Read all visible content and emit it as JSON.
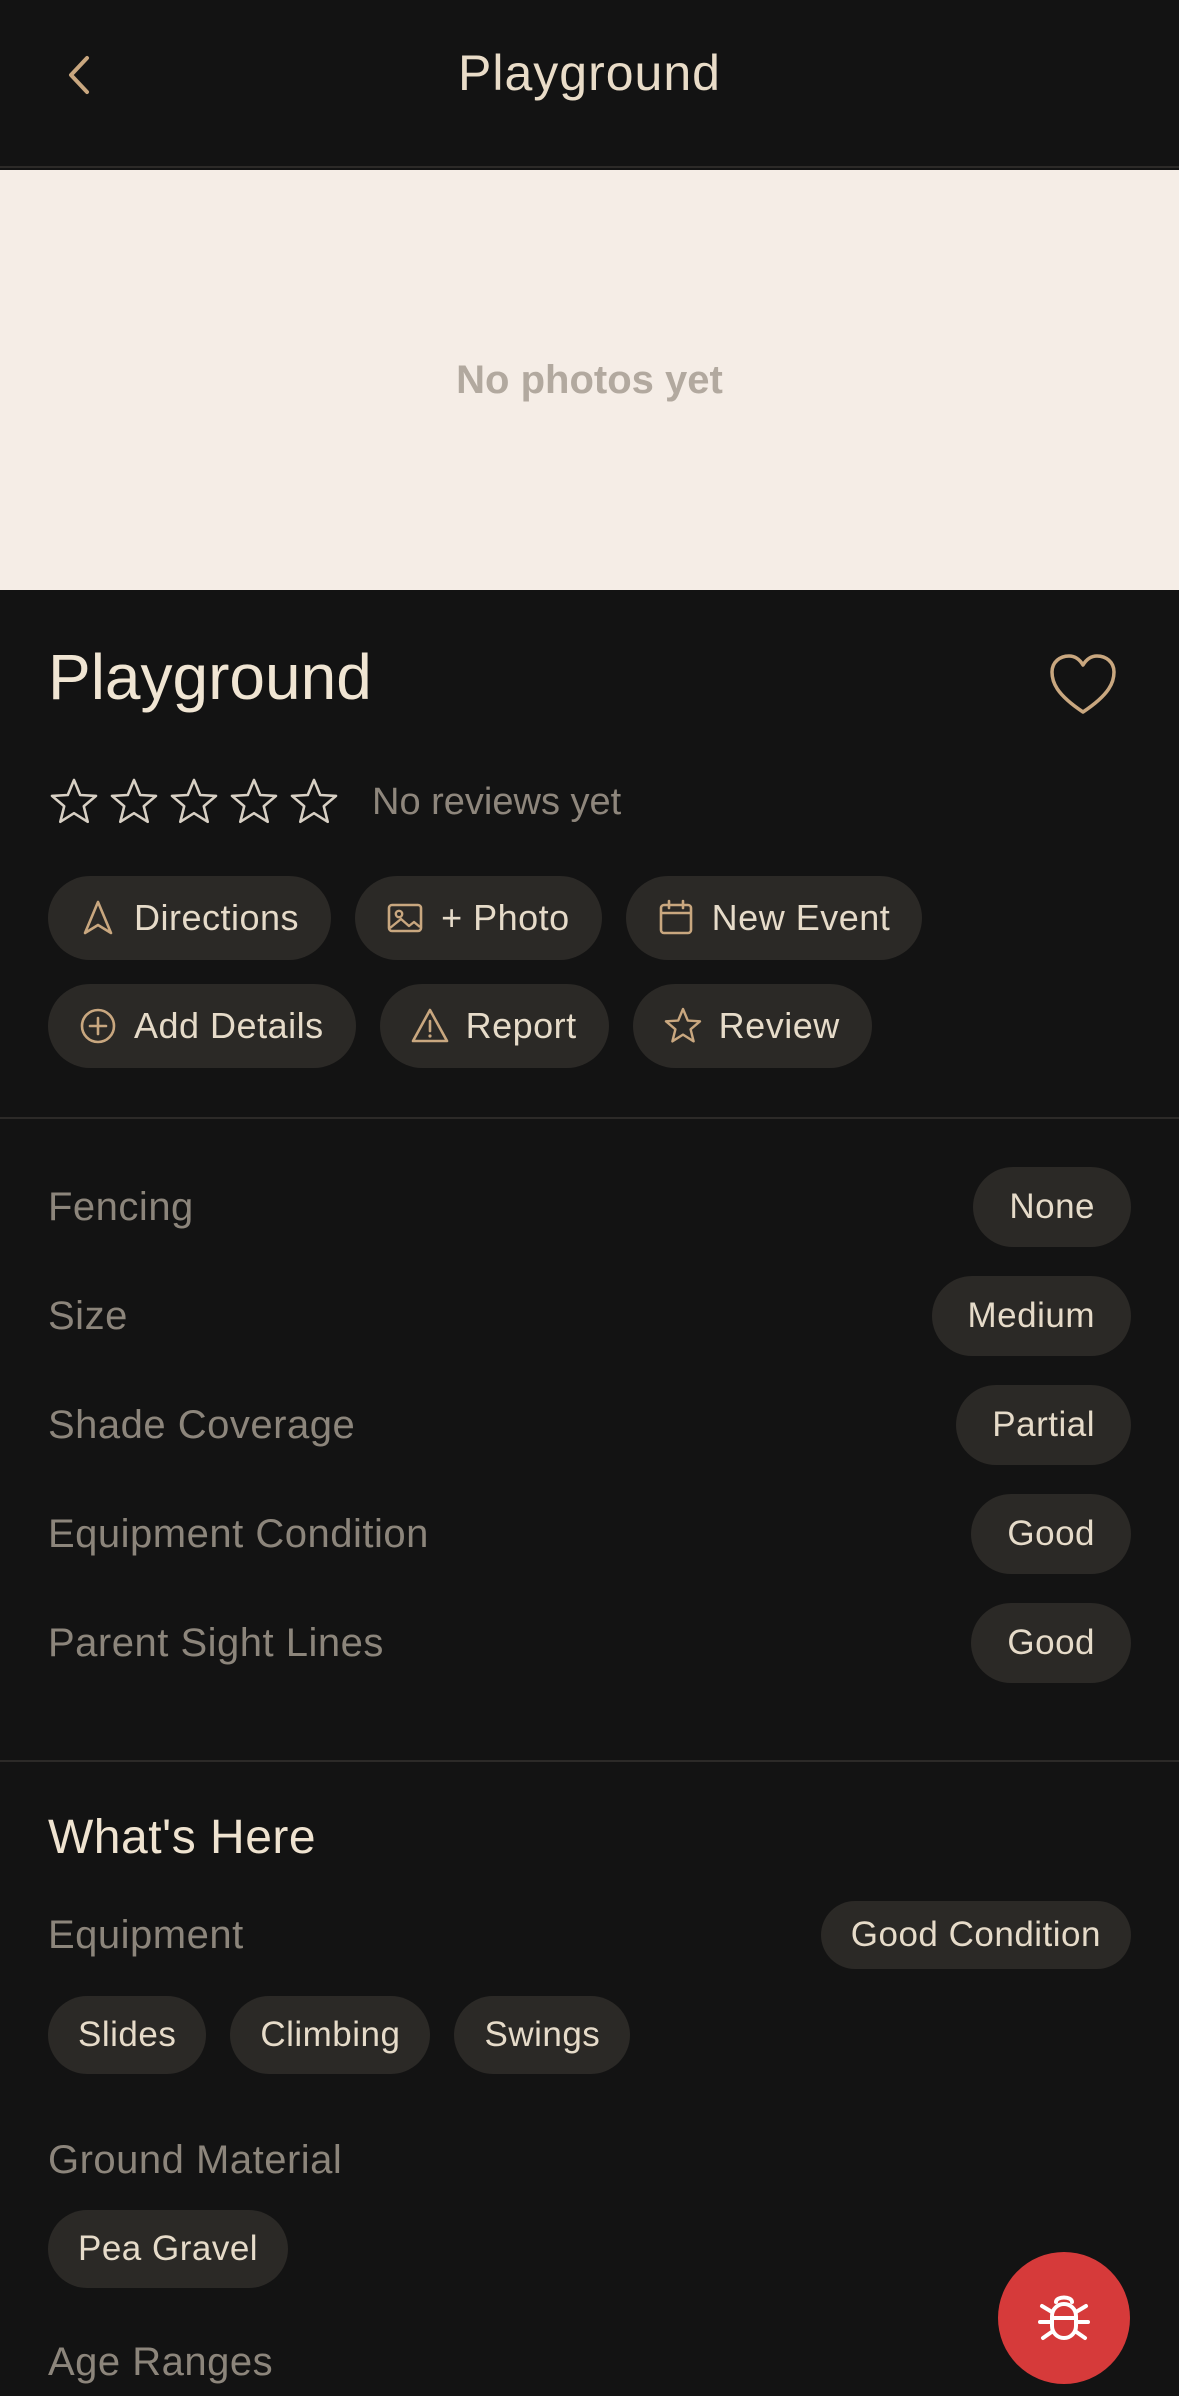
{
  "header": {
    "title": "Playground"
  },
  "photos": {
    "empty_text": "No photos yet"
  },
  "place": {
    "title": "Playground",
    "rating": 0,
    "rating_max": 5,
    "reviews_text": "No reviews yet"
  },
  "actions": [
    {
      "label": "Directions",
      "icon": "navigation-arrow-icon"
    },
    {
      "label": "+ Photo",
      "icon": "image-icon"
    },
    {
      "label": "New Event",
      "icon": "calendar-icon"
    },
    {
      "label": "Add Details",
      "icon": "plus-circle-icon"
    },
    {
      "label": "Report",
      "icon": "warning-triangle-icon"
    },
    {
      "label": "Review",
      "icon": "star-icon"
    }
  ],
  "attributes": [
    {
      "label": "Fencing",
      "value": "None"
    },
    {
      "label": "Size",
      "value": "Medium"
    },
    {
      "label": "Shade Coverage",
      "value": "Partial"
    },
    {
      "label": "Equipment Condition",
      "value": "Good"
    },
    {
      "label": "Parent Sight Lines",
      "value": "Good"
    }
  ],
  "whats_here": {
    "title": "What's Here",
    "equipment": {
      "label": "Equipment",
      "badge": "Good Condition",
      "items": [
        "Slides",
        "Climbing",
        "Swings"
      ]
    },
    "ground": {
      "label": "Ground Material",
      "items": [
        "Pea Gravel"
      ]
    },
    "age": {
      "label": "Age Ranges"
    }
  },
  "colors": {
    "background": "#131313",
    "chip": "#2b2926",
    "accent": "#c9a77f",
    "bug_button": "#d63a3a"
  }
}
